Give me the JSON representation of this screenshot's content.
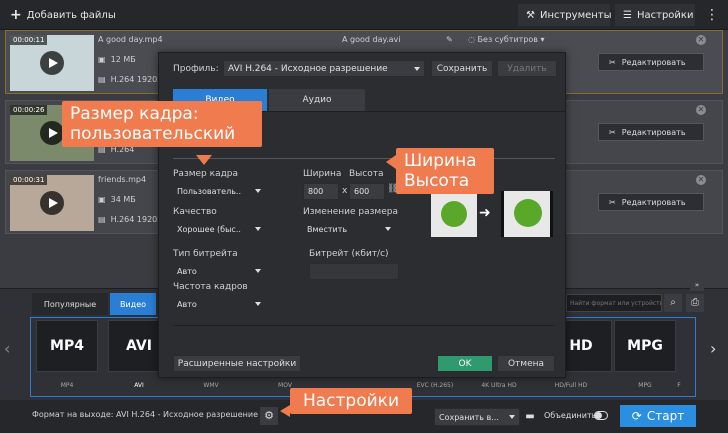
{
  "toolbar": {
    "add_files": "Добавить файлы",
    "tools": "Инструменты",
    "settings": "Настройки"
  },
  "files": [
    {
      "time": "00:00:11",
      "name": "A good day.mp4",
      "size": "12 МБ",
      "codec": "H.264 1920x",
      "out_name": "A good day.avi",
      "subs": "Без субтитров"
    },
    {
      "time": "00:00:26",
      "codec": "H.264"
    },
    {
      "time": "00:00:31",
      "name": "friends.mp4",
      "size": "34 МБ",
      "codec": "H.264 1920x"
    }
  ],
  "edit_label": "Редактировать",
  "dialog": {
    "profile_label": "Профиль:",
    "profile_value": "AVI H.264 - Исходное разрешение",
    "save": "Сохранить",
    "delete": "Удалить",
    "tabs": [
      "Видео",
      "Аудио"
    ],
    "frame_size_label": "Размер кадра",
    "frame_size_value": "Пользователь..",
    "width_label": "Ширина",
    "height_label": "Высота",
    "width_value": "800",
    "x": "x",
    "height_value": "600",
    "quality_label": "Качество",
    "quality_value": "Хорошее (быс..",
    "resize_label": "Изменение размера",
    "resize_value": "Вместить",
    "bitrate_type_label": "Тип битрейта",
    "bitrate_type_value": "Авто",
    "bitrate_label": "Битрейт (кбит/с)",
    "fps_label": "Частота кадров",
    "fps_value": "Авто",
    "advanced": "Расширенные настройки",
    "ok": "OK",
    "cancel": "Отмена"
  },
  "callouts": {
    "frame": "Размер кадра: пользовательский",
    "wh1": "Ширина",
    "wh2": "Высота",
    "settings": "Настройки"
  },
  "formats": {
    "tabs": [
      "Популярные",
      "Видео"
    ],
    "search_placeholder": "Найти формат или устройство...",
    "cards": [
      {
        "t": "MP4",
        "l": "MP4"
      },
      {
        "t": "AVI",
        "l": "AVI"
      },
      {
        "t": "",
        "l": "WMV"
      },
      {
        "t": "",
        "l": "MOV"
      },
      {
        "t": "",
        "l": "EVC (H.265)"
      },
      {
        "t": "",
        "l": "4K Ultra HD"
      },
      {
        "t": "HD",
        "l": "HD/Full HD"
      },
      {
        "t": "MPG",
        "l": "MPG"
      },
      {
        "t": "",
        "l": "F"
      }
    ]
  },
  "bottom": {
    "output": "Формат на выходе: AVI H.264 - Исходное разрешение",
    "save_to": "Сохранить в...",
    "merge": "Объединить",
    "start": "Старт"
  },
  "colors": {
    "accent": "#f07b4f",
    "ok": "#2f9a6e",
    "start": "#2a8fe0",
    "tab_active": "#2a7fd4"
  }
}
